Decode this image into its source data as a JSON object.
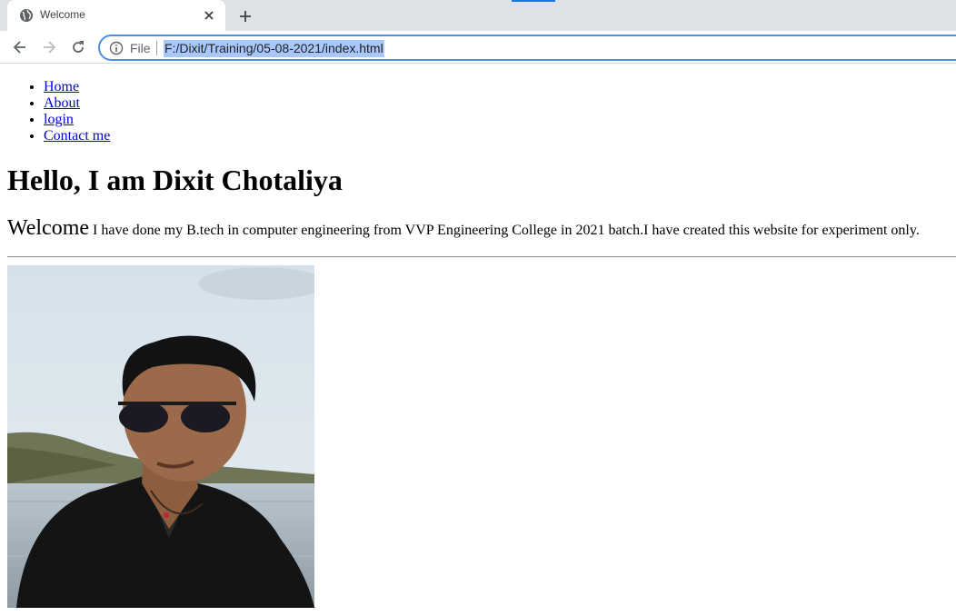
{
  "browser": {
    "tab": {
      "title": "Welcome"
    },
    "omnibox": {
      "scheme_label": "File",
      "url": "F:/Dixit/Training/05-08-2021/index.html"
    }
  },
  "colors": {
    "link": "#0000ee",
    "omnibox_border": "#4d8fe6",
    "url_selection": "#a8c7fa",
    "tabstrip": "#dee1e6"
  },
  "icons": {
    "favicon": "globe-icon",
    "close": "close-icon",
    "new_tab": "plus-icon",
    "back": "back-arrow-icon",
    "forward": "forward-arrow-icon",
    "reload": "reload-icon",
    "info": "info-icon"
  },
  "nav": {
    "items": [
      {
        "label": "Home"
      },
      {
        "label": "About"
      },
      {
        "label": "login"
      },
      {
        "label": "Contact me"
      }
    ]
  },
  "main": {
    "heading": "Hello, I am Dixit Chotaliya",
    "intro_big": "Welcome",
    "intro_text": "I have done my B.tech in computer engineering from VVP Engineering College in 2021 batch.I have created this website for experiment only."
  }
}
